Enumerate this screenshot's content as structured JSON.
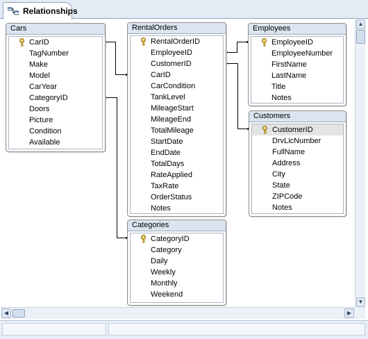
{
  "tab": {
    "label": "Relationships",
    "icon": "relationships-icon"
  },
  "tables": [
    {
      "id": "cars",
      "title": "Cars",
      "fields": [
        {
          "name": "CarID",
          "key": true
        },
        {
          "name": "TagNumber"
        },
        {
          "name": "Make"
        },
        {
          "name": "Model"
        },
        {
          "name": "CarYear"
        },
        {
          "name": "CategoryID"
        },
        {
          "name": "Doors"
        },
        {
          "name": "Picture"
        },
        {
          "name": "Condition"
        },
        {
          "name": "Available"
        }
      ]
    },
    {
      "id": "rentalorders",
      "title": "RentalOrders",
      "fields": [
        {
          "name": "RentalOrderID",
          "key": true
        },
        {
          "name": "EmployeeID"
        },
        {
          "name": "CustomerID"
        },
        {
          "name": "CarID"
        },
        {
          "name": "CarCondition"
        },
        {
          "name": "TankLevel"
        },
        {
          "name": "MileageStart"
        },
        {
          "name": "MileageEnd"
        },
        {
          "name": "TotalMileage"
        },
        {
          "name": "StartDate"
        },
        {
          "name": "EndDate"
        },
        {
          "name": "TotalDays"
        },
        {
          "name": "RateApplied"
        },
        {
          "name": "TaxRate"
        },
        {
          "name": "OrderStatus"
        },
        {
          "name": "Notes"
        }
      ]
    },
    {
      "id": "employees",
      "title": "Employees",
      "fields": [
        {
          "name": "EmployeeID",
          "key": true
        },
        {
          "name": "EmployeeNumber"
        },
        {
          "name": "FirstName"
        },
        {
          "name": "LastName"
        },
        {
          "name": "Title"
        },
        {
          "name": "Notes"
        }
      ]
    },
    {
      "id": "customers",
      "title": "Customers",
      "fields": [
        {
          "name": "CustomerID",
          "key": true,
          "selected": true
        },
        {
          "name": "DrvLicNumber"
        },
        {
          "name": "FullName"
        },
        {
          "name": "Address"
        },
        {
          "name": "City"
        },
        {
          "name": "State"
        },
        {
          "name": "ZIPCode"
        },
        {
          "name": "Notes"
        }
      ]
    },
    {
      "id": "categories",
      "title": "Categories",
      "fields": [
        {
          "name": "CategoryID",
          "key": true
        },
        {
          "name": "Category"
        },
        {
          "name": "Daily"
        },
        {
          "name": "Weekly"
        },
        {
          "name": "Monthly"
        },
        {
          "name": "Weekend"
        }
      ]
    }
  ],
  "scrollbars": {
    "up_icon": "scroll-up-arrow-icon",
    "down_icon": "scroll-down-arrow-icon",
    "left_icon": "scroll-left-arrow-icon",
    "right_icon": "scroll-right-arrow-icon"
  },
  "colors": {
    "header_bg": "#dbe4f0",
    "selected_field_bg": "#e3e3e3",
    "key_icon": "#c9a227",
    "tab_strip": "#e3ebf5"
  }
}
